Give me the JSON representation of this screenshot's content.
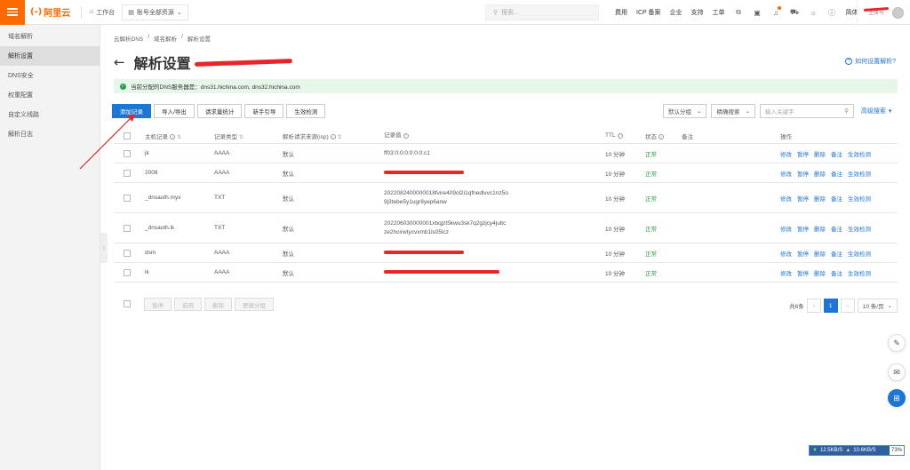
{
  "topbar": {
    "logo_mark": "(-)",
    "logo_text": "阿里云",
    "workbench": "工作台",
    "account_resources": "账号全部资源",
    "search_placeholder": "搜索...",
    "nav": [
      "费用",
      "ICP 备案",
      "企业",
      "支持",
      "工单"
    ],
    "lang": "简体",
    "user_label": "主账号"
  },
  "sidebar": {
    "items": [
      "域名解析",
      "解析设置",
      "DNS安全",
      "权重配置",
      "自定义线路",
      "解析日志"
    ],
    "active_index": 1
  },
  "breadcrumb": [
    "云解析DNS",
    "/",
    "域名解析",
    "/",
    "解析设置"
  ],
  "page_title": "解析设置",
  "help_link": "如何设置解析?",
  "notice": "当前分配的DNS服务器是：dns31.hichina.com, dns32.hichina.com",
  "toolbar": {
    "buttons": [
      "添加记录",
      "导入/导出",
      "请求量统计",
      "新手引导",
      "生效检测"
    ]
  },
  "filters": {
    "group": "默认分组",
    "search_mode": "精确搜索",
    "keyword_placeholder": "输入关键字",
    "advanced": "高级搜索"
  },
  "table": {
    "headers": {
      "host": "主机记录",
      "type": "记录类型",
      "line": "解析请求来源(isp)",
      "value": "记录值",
      "ttl": "TTL",
      "status": "状态",
      "note": "备注",
      "ops": "操作"
    },
    "ops": [
      "修改",
      "暂停",
      "删除",
      "备注",
      "生效检测"
    ],
    "rows": [
      {
        "host": "jk",
        "type": "AAAA",
        "line": "默认",
        "value": "ff03:0:0:0:0:0:0:c1",
        "ttl": "10 分钟",
        "status": "正常"
      },
      {
        "host": "2008",
        "type": "AAAA",
        "line": "默认",
        "value": "",
        "ttl": "10 分钟",
        "status": "正常"
      },
      {
        "host": "_dnsauth.myx",
        "type": "TXT",
        "line": "默认",
        "value": "2022082400000018fvire409ol2i1qfnedlvvc1nz5o9j3tebe5y1ugr8yep6anw",
        "ttl": "10 分钟",
        "status": "正常"
      },
      {
        "host": "_dnsauth.ik",
        "type": "TXT",
        "line": "默认",
        "value": "202206030000001xbqjzt5kwu3sk7q2gzjcy4jultcze2hcirwtycvxmb1ls05lcz",
        "ttl": "10 分钟",
        "status": "正常"
      },
      {
        "host": "dsm",
        "type": "AAAA",
        "line": "默认",
        "value": "",
        "ttl": "10 分钟",
        "status": "正常"
      },
      {
        "host": "ik",
        "type": "AAAA",
        "line": "默认",
        "value": "",
        "ttl": "10 分钟",
        "status": "正常"
      }
    ]
  },
  "bulk_buttons": [
    "暂停",
    "启用",
    "删除",
    "更换分组"
  ],
  "pager": {
    "total": "共6条",
    "current": "1",
    "page_size": "10 条/页"
  },
  "netbar": {
    "up": "12.5KB/S",
    "down": "10.6KB/S",
    "pct": "73%"
  },
  "colors": {
    "brand": "#ff6a00",
    "primary": "#1e75d6",
    "success": "#2a9d4a",
    "redact": "#e8262a"
  }
}
